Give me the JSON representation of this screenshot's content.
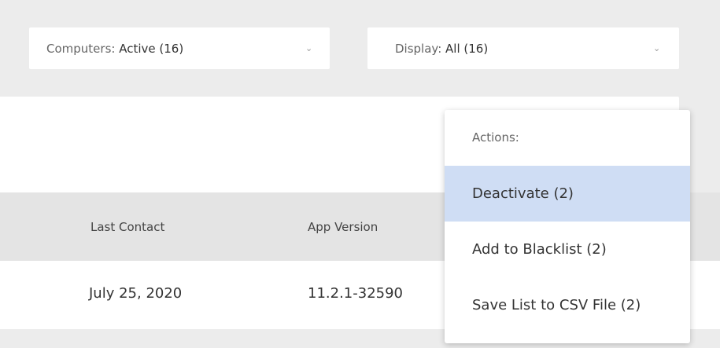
{
  "filters": {
    "computers": {
      "label": "Computers:",
      "value": "Active (16)"
    },
    "display": {
      "label": "Display:",
      "value": "All (16)"
    }
  },
  "table": {
    "columns": [
      "Last Contact",
      "App Version"
    ],
    "rows": [
      {
        "last_contact": "July 25, 2020",
        "app_version": "11.2.1-32590"
      }
    ]
  },
  "actions_menu": {
    "header": "Actions:",
    "items": [
      "Deactivate (2)",
      "Add to Blacklist (2)",
      "Save List to CSV File (2)"
    ],
    "highlighted_index": 0,
    "highlight_color": "#cfddf4"
  }
}
